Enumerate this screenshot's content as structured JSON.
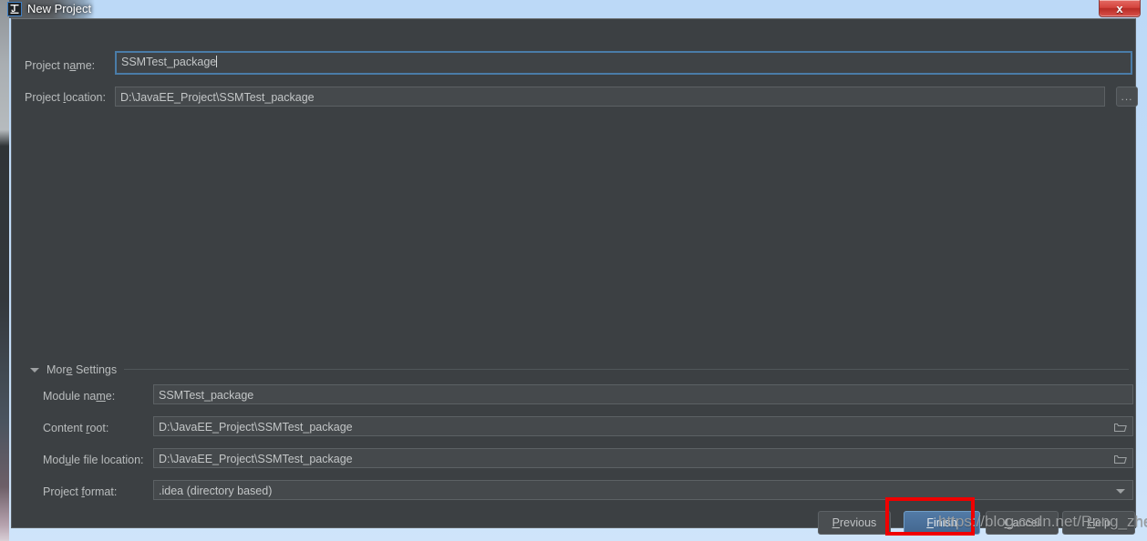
{
  "window": {
    "title": "New Project",
    "app_icon": "intellij-idea-icon",
    "close_label": "x"
  },
  "form": {
    "project_name": {
      "label_pre": "Project n",
      "label_mnemonic": "a",
      "label_post": "me:",
      "value": "SSMTest_package",
      "focused": true
    },
    "project_location": {
      "label_pre": "Project ",
      "label_mnemonic": "l",
      "label_post": "ocation:",
      "value": "D:\\JavaEE_Project\\SSMTest_package",
      "browse_label": "..."
    }
  },
  "more_settings": {
    "label_pre": "Mor",
    "label_mnemonic": "e",
    "label_post": " Settings",
    "expanded": true,
    "rows": [
      {
        "name": "module-name",
        "label_pre": "Module na",
        "label_mnemonic": "m",
        "label_post": "e:",
        "value": "SSMTest_package",
        "trailing_icon": null
      },
      {
        "name": "content-root",
        "label_pre": "Content ",
        "label_mnemonic": "r",
        "label_post": "oot:",
        "value": "D:\\JavaEE_Project\\SSMTest_package",
        "trailing_icon": "folder-icon"
      },
      {
        "name": "module-file-location",
        "label_pre": "Mod",
        "label_mnemonic": "u",
        "label_post": "le file location:",
        "value": "D:\\JavaEE_Project\\SSMTest_package",
        "trailing_icon": "folder-icon"
      },
      {
        "name": "project-format",
        "label_pre": "Project ",
        "label_mnemonic": "f",
        "label_post": "ormat:",
        "value": ".idea (directory based)",
        "trailing_icon": "chevron-down-icon"
      }
    ]
  },
  "buttons": {
    "previous": {
      "pre": "",
      "mnemonic": "P",
      "post": "revious"
    },
    "finish": {
      "pre": "",
      "mnemonic": "F",
      "post": "inish"
    },
    "cancel": {
      "pre": "",
      "mnemonic": "C",
      "post": "ancel"
    },
    "help": {
      "pre": "",
      "mnemonic": "H",
      "post": "elp"
    }
  },
  "annotation": {
    "target": "finish-button",
    "color": "#f00000"
  },
  "watermark": {
    "text": "https://blog.csdn.net/Rong_zhe"
  },
  "colors": {
    "dialog_bg": "#3c4043",
    "field_bg": "#45494c",
    "focus_border": "#4a7ca8",
    "primary_button": "#43678f",
    "titlebar": "#bcd9f7"
  }
}
